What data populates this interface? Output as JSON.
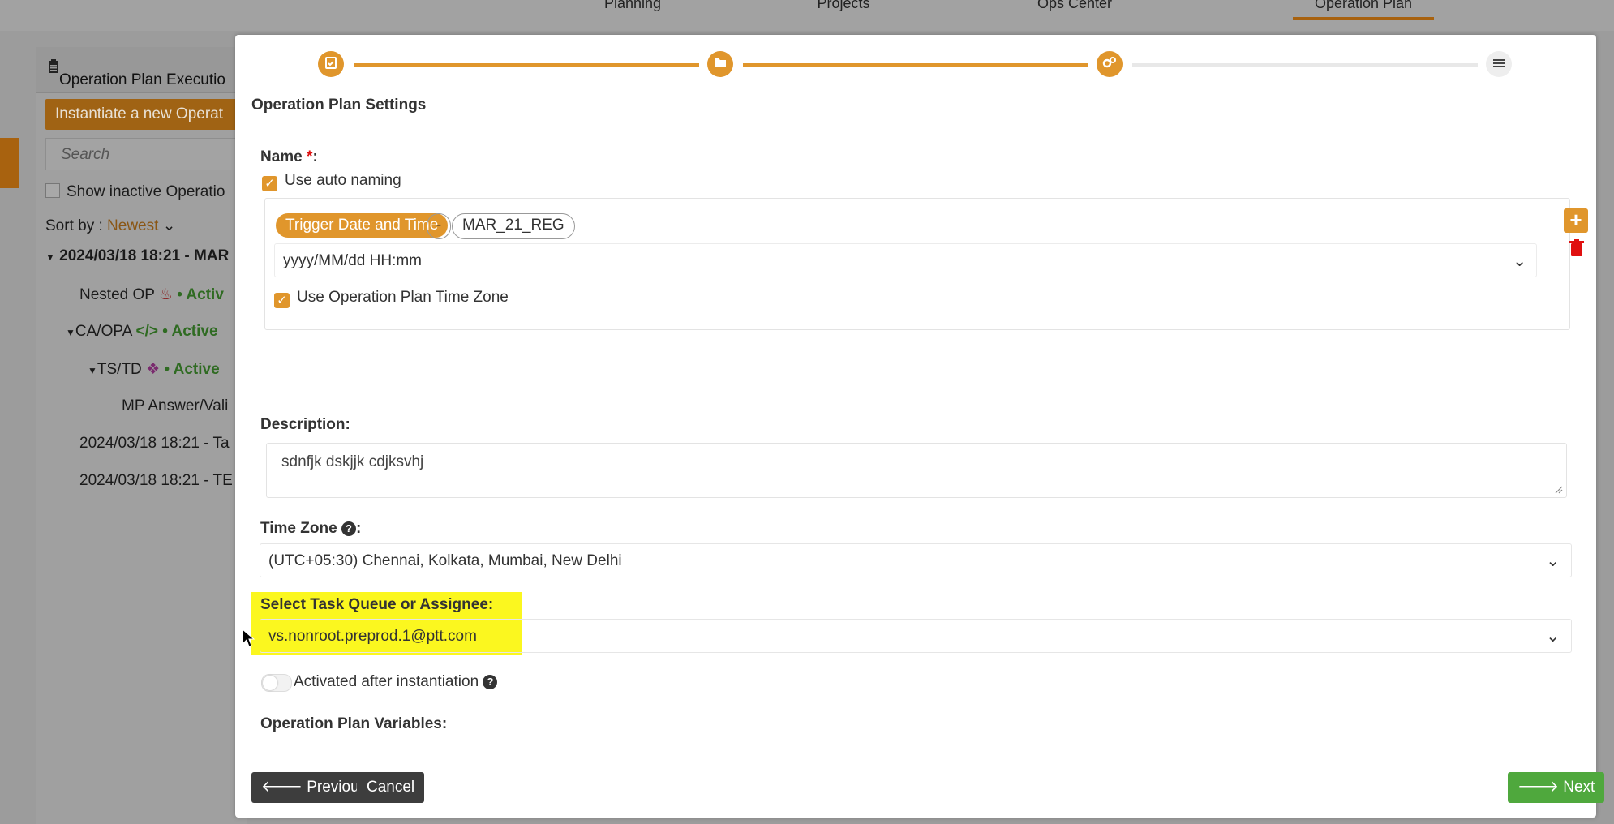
{
  "topnav": {
    "tabs": [
      {
        "label": "Planning"
      },
      {
        "label": "Projects"
      },
      {
        "label": "Ops Center"
      },
      {
        "label": "Operation Plan",
        "active": true
      }
    ]
  },
  "background_panel": {
    "title": "Operation Plan Executio",
    "instantiate_button": "Instantiate a new Operat",
    "search_placeholder": "Search",
    "show_inactive": "Show inactive Operatio",
    "sort_label": "Sort by :",
    "sort_value": "Newest",
    "tree": [
      {
        "label": "2024/03/18 18:21 - MAR"
      },
      {
        "label": "Nested OP",
        "status": "• Activ"
      },
      {
        "label": "CA/OPA",
        "status": "• Active"
      },
      {
        "label": "TS/TD",
        "status": "• Active"
      },
      {
        "label": "MP Answer/Vali"
      },
      {
        "label": "2024/03/18 18:21 - Ta"
      },
      {
        "label": "2024/03/18 18:21 - TE"
      }
    ]
  },
  "modal": {
    "section_title": "Operation Plan Settings",
    "name_label": "Name",
    "required_marker": "*",
    "name_colon": ":",
    "use_auto_naming": "Use auto naming",
    "name_parts": {
      "trigger": "Trigger Date and Time",
      "separator": "-",
      "suffix": "MAR_21_REG"
    },
    "date_format": "yyyy/MM/dd HH:mm",
    "use_tz": "Use Operation Plan Time Zone",
    "description_label": "Description:",
    "description_value": "sdnfjk dskjjk cdjksvhj",
    "timezone_label": "Time Zone",
    "timezone_colon": ":",
    "timezone_value": "(UTC+05:30) Chennai, Kolkata, Mumbai, New Delhi",
    "task_queue_label": "Select Task Queue or Assignee:",
    "task_queue_value": "vs.nonroot.preprod.1@ptt.com",
    "activated_label": "Activated after instantiation",
    "variables_label": "Operation Plan Variables:",
    "buttons": {
      "previous": "Previous",
      "cancel": "Cancel",
      "next": "Next"
    }
  },
  "colors": {
    "accent": "#e0962c",
    "highlight": "#fbf71f",
    "next_button": "#4fa83d",
    "dark_button": "#3d3d3d",
    "active_status": "#2f6b22",
    "required": "#dd1111"
  },
  "icons": [
    "clipboard-icon",
    "folder-icon",
    "gears-icon",
    "sliders-icon",
    "plus-icon",
    "trash-icon",
    "chevron-down-icon",
    "question-circle-icon",
    "arrow-left-icon",
    "arrow-right-icon",
    "fire-icon",
    "code-icon",
    "fingerprint-icon",
    "caret-down-icon",
    "mouse-cursor-icon"
  ]
}
